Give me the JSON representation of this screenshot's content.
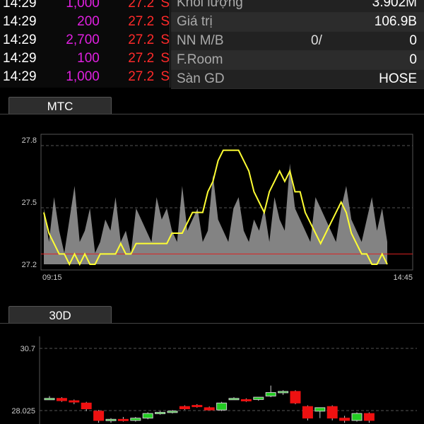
{
  "trades": [
    {
      "time": "14:29",
      "qty": "1,000",
      "price": "27.2",
      "side": "S"
    },
    {
      "time": "14:29",
      "qty": "200",
      "price": "27.2",
      "side": "S"
    },
    {
      "time": "14:29",
      "qty": "2,700",
      "price": "27.2",
      "side": "S"
    },
    {
      "time": "14:29",
      "qty": "100",
      "price": "27.2",
      "side": "S"
    },
    {
      "time": "14:29",
      "qty": "1,000",
      "price": "27.2",
      "side": "S"
    }
  ],
  "info": [
    {
      "key": "Khối lượng",
      "value": "3.902M"
    },
    {
      "key": "Giá trị",
      "value": "106.9B"
    },
    {
      "key": "NN M/B",
      "mid": "0/",
      "value": "0"
    },
    {
      "key": "F.Room",
      "value": "0"
    },
    {
      "key": "Sàn GD",
      "value": "HOSE"
    }
  ],
  "tabs": {
    "intraday": "MTC",
    "daily": "30D"
  },
  "colors": {
    "up": "#22cc22",
    "down": "#ee1111",
    "line": "#ffff33",
    "reference": "#dd2222",
    "volume": "#9a9a9a",
    "qty": "#e020e0"
  },
  "chart_data": [
    {
      "type": "line",
      "title": "MTC",
      "x_ticks": [
        "09:15",
        "14:45"
      ],
      "y_ticks": [
        27.8,
        27.5,
        27.2
      ],
      "ylim": [
        27.2,
        27.8
      ],
      "reference_price": 27.25,
      "series": [
        {
          "values": [
            27.45,
            27.35,
            27.3,
            27.25,
            27.25,
            27.2,
            27.25,
            27.2,
            27.25,
            27.2,
            27.2,
            27.25,
            27.25,
            27.25,
            27.25,
            27.3,
            27.25,
            27.25,
            27.3,
            27.3,
            27.3,
            27.3,
            27.3,
            27.3,
            27.3,
            27.35,
            27.35,
            27.35,
            27.4,
            27.45,
            27.45,
            27.45,
            27.55,
            27.6,
            27.7,
            27.75,
            27.75,
            27.75,
            27.75,
            27.7,
            27.65,
            27.55,
            27.5,
            27.45,
            27.55,
            27.6,
            27.65,
            27.6,
            27.65,
            27.55,
            27.55,
            27.45,
            27.4,
            27.35,
            27.3,
            27.35,
            27.4,
            27.45,
            27.5,
            27.45,
            27.35,
            27.3,
            27.25,
            27.25,
            27.2,
            27.2,
            27.25,
            27.2
          ]
        }
      ],
      "volume": [
        0.5,
        0.2,
        0.6,
        0.3,
        0.1,
        0.4,
        0.7,
        0.2,
        0.3,
        0.5,
        0.1,
        0.2,
        0.4,
        0.3,
        0.6,
        0.2,
        0.3,
        0.1,
        0.5,
        0.4,
        0.3,
        0.2,
        0.6,
        0.4,
        0.5,
        0.3,
        0.2,
        0.7,
        0.3,
        0.4,
        0.5,
        0.2,
        0.3,
        0.8,
        0.4,
        0.3,
        0.2,
        0.5,
        0.6,
        0.3,
        0.2,
        0.4,
        0.3,
        0.5,
        0.2,
        0.6,
        0.4,
        0.3,
        0.9,
        0.5,
        0.4,
        0.3,
        0.2,
        0.6,
        0.5,
        0.4,
        0.3,
        0.2,
        0.5,
        0.7,
        0.4,
        0.3,
        0.2,
        0.4,
        0.6,
        0.3,
        0.5,
        0.2
      ]
    },
    {
      "type": "candlestick",
      "title": "30D",
      "y_ticks": [
        30.7,
        28.025
      ],
      "candles": [
        {
          "o": 28.55,
          "h": 28.65,
          "l": 28.5,
          "c": 28.55
        },
        {
          "o": 28.55,
          "h": 28.6,
          "l": 28.4,
          "c": 28.45
        },
        {
          "o": 28.45,
          "h": 28.5,
          "l": 28.3,
          "c": 28.4
        },
        {
          "o": 28.35,
          "h": 28.4,
          "l": 28.0,
          "c": 28.1
        },
        {
          "o": 28.0,
          "h": 28.05,
          "l": 27.5,
          "c": 27.6
        },
        {
          "o": 27.6,
          "h": 27.7,
          "l": 27.5,
          "c": 27.65
        },
        {
          "o": 27.65,
          "h": 27.75,
          "l": 27.55,
          "c": 27.6
        },
        {
          "o": 27.6,
          "h": 27.75,
          "l": 27.55,
          "c": 27.7
        },
        {
          "o": 27.7,
          "h": 27.95,
          "l": 27.65,
          "c": 27.9
        },
        {
          "o": 27.9,
          "h": 28.0,
          "l": 27.85,
          "c": 27.95
        },
        {
          "o": 27.95,
          "h": 28.05,
          "l": 27.9,
          "c": 28.0
        },
        {
          "o": 28.2,
          "h": 28.25,
          "l": 28.05,
          "c": 28.1
        },
        {
          "o": 28.25,
          "h": 28.3,
          "l": 28.15,
          "c": 28.2
        },
        {
          "o": 28.15,
          "h": 28.2,
          "l": 28.05,
          "c": 28.05
        },
        {
          "o": 28.05,
          "h": 28.4,
          "l": 28.0,
          "c": 28.35
        },
        {
          "o": 28.55,
          "h": 28.6,
          "l": 28.5,
          "c": 28.55
        },
        {
          "o": 28.5,
          "h": 28.55,
          "l": 28.4,
          "c": 28.45
        },
        {
          "o": 28.5,
          "h": 28.6,
          "l": 28.45,
          "c": 28.6
        },
        {
          "o": 28.65,
          "h": 29.1,
          "l": 28.6,
          "c": 28.8
        },
        {
          "o": 28.8,
          "h": 28.9,
          "l": 28.7,
          "c": 28.85
        },
        {
          "o": 28.85,
          "h": 28.9,
          "l": 28.3,
          "c": 28.35
        },
        {
          "o": 28.2,
          "h": 28.25,
          "l": 27.6,
          "c": 27.7
        },
        {
          "o": 28.0,
          "h": 28.15,
          "l": 27.7,
          "c": 28.15
        },
        {
          "o": 28.2,
          "h": 28.25,
          "l": 27.6,
          "c": 27.7
        },
        {
          "o": 27.7,
          "h": 27.8,
          "l": 27.5,
          "c": 27.6
        },
        {
          "o": 27.6,
          "h": 27.95,
          "l": 27.55,
          "c": 27.9
        },
        {
          "o": 27.9,
          "h": 27.95,
          "l": 27.5,
          "c": 27.6
        }
      ]
    }
  ]
}
